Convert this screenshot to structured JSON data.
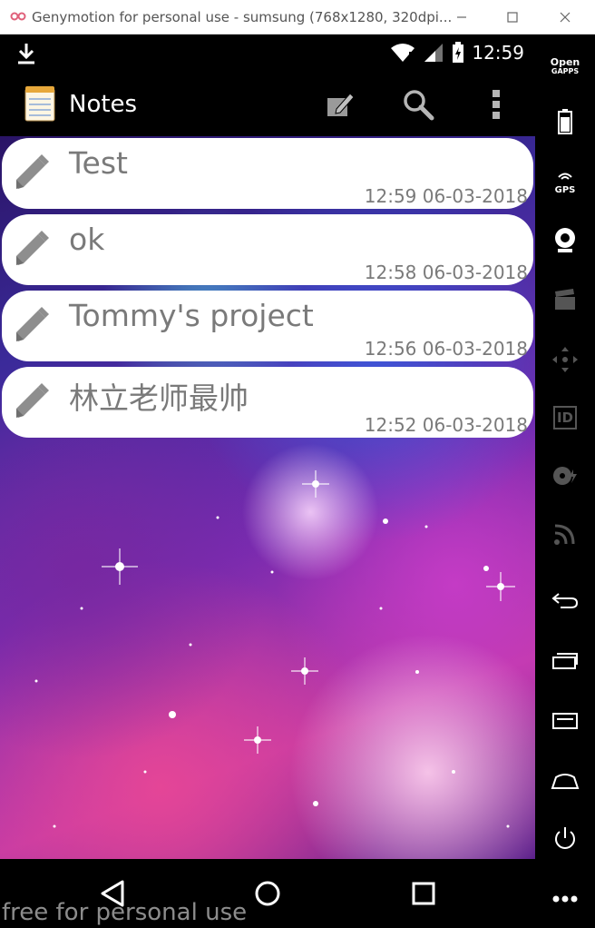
{
  "window": {
    "title": "Genymotion for personal use - sumsung (768x1280, 320dpi...",
    "minimize_icon": "minimize-icon",
    "maximize_icon": "maximize-icon",
    "close_icon": "close-icon"
  },
  "statusbar": {
    "time": "12:59",
    "icons": [
      "download-icon",
      "wifi-icon",
      "signal-icon",
      "battery-charging-icon"
    ]
  },
  "actionbar": {
    "title": "Notes",
    "actions": [
      "compose-icon",
      "search-icon",
      "overflow-menu-icon"
    ]
  },
  "notes": [
    {
      "title": "Test",
      "time": "12:59 06-03-2018"
    },
    {
      "title": "ok",
      "time": "12:58 06-03-2018"
    },
    {
      "title": "Tommy's project",
      "time": "12:56 06-03-2018"
    },
    {
      "title": "林立老师最帅",
      "time": "12:52 06-03-2018"
    }
  ],
  "navbar": {
    "buttons": [
      "back-icon",
      "home-icon",
      "recents-icon"
    ],
    "watermark": "free for personal use"
  },
  "sidebar": {
    "gapps_label_line1": "Open",
    "gapps_label_line2": "GAPPS",
    "gps_label": "GPS",
    "id_label": "ID",
    "tools": [
      "open-gapps",
      "battery",
      "gps",
      "webcam",
      "capture",
      "dpad",
      "device-id",
      "disk-io",
      "cast",
      "back",
      "recent-apps",
      "menu",
      "home",
      "power",
      "more"
    ]
  },
  "colors": {
    "note_card": "#ffffff",
    "note_text": "#7a7a7a",
    "chrome": "#000000"
  }
}
